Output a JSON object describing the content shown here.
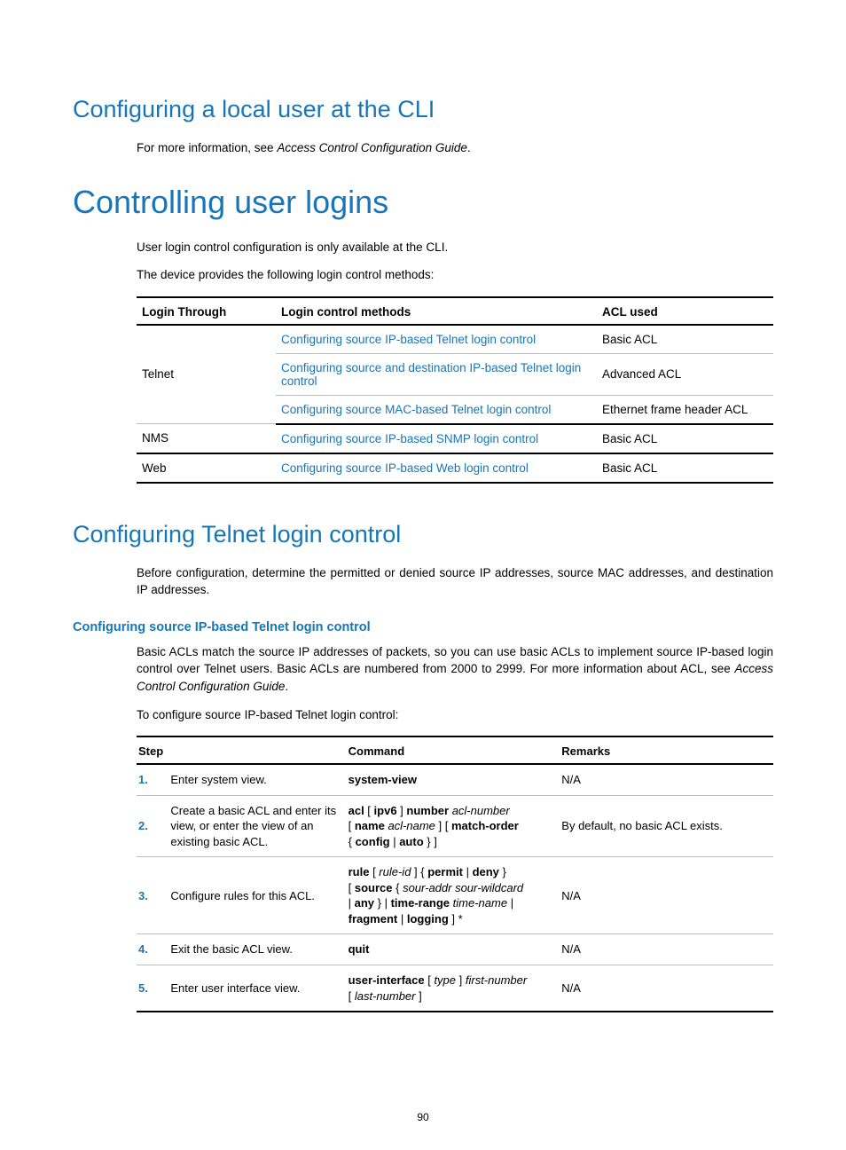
{
  "headings": {
    "h2_local_user": "Configuring a local user at the CLI",
    "h1_controlling": "Controlling user logins",
    "h2_telnet": "Configuring Telnet login control",
    "h4_src_ip": "Configuring source IP-based Telnet login control"
  },
  "paragraphs": {
    "local_user_pre": "For more information, see ",
    "local_user_ref": "Access Control Configuration Guide",
    "local_user_post": ".",
    "ctrl_p1": "User login control configuration is only available at the CLI.",
    "ctrl_p2": "The device provides the following login control methods:",
    "telnet_p1": "Before configuration, determine the permitted or denied source IP addresses, source MAC addresses, and destination IP addresses.",
    "srcip_p1_pre": "Basic ACLs match the source IP addresses of packets, so you can use basic ACLs to implement source IP-based login control over Telnet users. Basic ACLs are numbered from 2000 to 2999. For more information about ACL, see ",
    "srcip_p1_ref": "Access Control Configuration Guide",
    "srcip_p1_post": ".",
    "srcip_p2": "To configure source IP-based Telnet login control:"
  },
  "table1": {
    "head": {
      "c1": "Login Through",
      "c2": "Login control methods",
      "c3": "ACL used"
    },
    "rows": [
      {
        "c1": "Telnet",
        "rowspan": 3,
        "c2": "Configuring source IP-based Telnet login control",
        "c3": "Basic ACL"
      },
      {
        "c2": "Configuring source and destination IP-based Telnet login control",
        "c3": "Advanced ACL"
      },
      {
        "c2": "Configuring source MAC-based Telnet login control",
        "c3": "Ethernet frame header ACL"
      },
      {
        "c1": "NMS",
        "rowspan": 1,
        "c2": "Configuring source IP-based SNMP login control",
        "c3": "Basic ACL"
      },
      {
        "c1": "Web",
        "rowspan": 1,
        "c2": "Configuring source IP-based Web login control",
        "c3": "Basic ACL"
      }
    ]
  },
  "table2": {
    "head": {
      "c1": "Step",
      "c2": "Command",
      "c3": "Remarks"
    },
    "rows": [
      {
        "n": "1.",
        "step": "Enter system view.",
        "cmd": [
          {
            "b": "system-view"
          }
        ],
        "rem": "N/A"
      },
      {
        "n": "2.",
        "step": "Create a basic ACL and enter its view, or enter the view of an existing basic ACL.",
        "cmd": [
          {
            "b": "acl"
          },
          {
            "t": " [ "
          },
          {
            "b": "ipv6"
          },
          {
            "t": " ] "
          },
          {
            "b": "number"
          },
          {
            "t": " "
          },
          {
            "i": "acl-number"
          },
          {
            "br": true
          },
          {
            "t": "[ "
          },
          {
            "b": "name"
          },
          {
            "t": " "
          },
          {
            "i": "acl-name"
          },
          {
            "t": " ] [ "
          },
          {
            "b": "match-order"
          },
          {
            "br": true
          },
          {
            "t": "{ "
          },
          {
            "b": "config"
          },
          {
            "t": " | "
          },
          {
            "b": "auto"
          },
          {
            "t": " } ]"
          }
        ],
        "rem": "By default, no basic ACL exists."
      },
      {
        "n": "3.",
        "step": "Configure rules for this ACL.",
        "cmd": [
          {
            "b": "rule"
          },
          {
            "t": " [ "
          },
          {
            "i": "rule-id"
          },
          {
            "t": " ] { "
          },
          {
            "b": "permit"
          },
          {
            "t": " | "
          },
          {
            "b": "deny"
          },
          {
            "t": " }"
          },
          {
            "br": true
          },
          {
            "t": "[ "
          },
          {
            "b": "source"
          },
          {
            "t": " { "
          },
          {
            "i": "sour-addr sour-wildcard"
          },
          {
            "br": true
          },
          {
            "t": " | "
          },
          {
            "b": "any"
          },
          {
            "t": " } | "
          },
          {
            "b": "time-range"
          },
          {
            "t": " "
          },
          {
            "i": "time-name"
          },
          {
            "t": " |"
          },
          {
            "br": true
          },
          {
            "b": "fragment"
          },
          {
            "t": " | "
          },
          {
            "b": "logging"
          },
          {
            "t": " ] *"
          }
        ],
        "rem": "N/A"
      },
      {
        "n": "4.",
        "step": "Exit the basic ACL view.",
        "cmd": [
          {
            "b": "quit"
          }
        ],
        "rem": "N/A"
      },
      {
        "n": "5.",
        "step": "Enter user interface view.",
        "cmd": [
          {
            "b": "user-interface"
          },
          {
            "t": " [ "
          },
          {
            "i": "type"
          },
          {
            "t": " ] "
          },
          {
            "i": "first-number"
          },
          {
            "br": true
          },
          {
            "t": "[ "
          },
          {
            "i": "last-number"
          },
          {
            "t": " ]"
          }
        ],
        "rem": "N/A"
      }
    ]
  },
  "page_number": "90"
}
